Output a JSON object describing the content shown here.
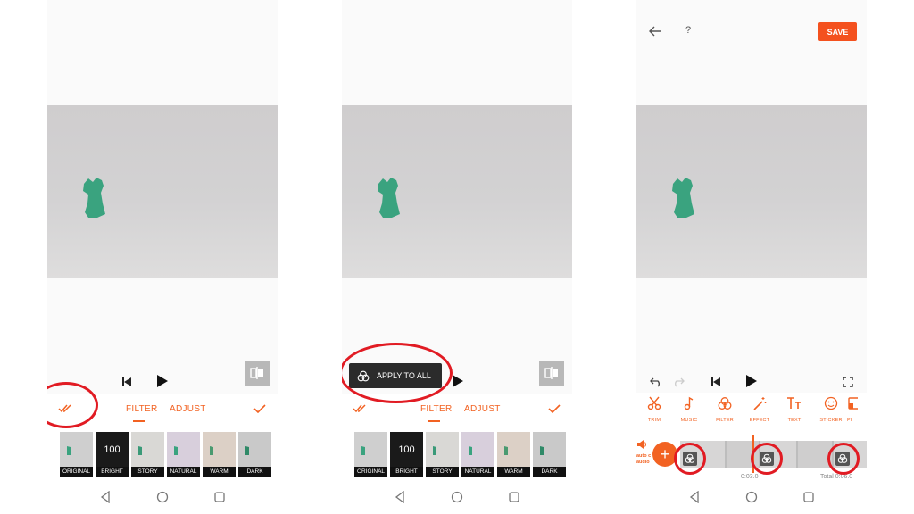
{
  "colors": {
    "accent": "#f26222",
    "highlight_ring": "#e11b23",
    "tooltip_bg": "#2b2b2b",
    "save_bg": "#f4511e"
  },
  "filter_screen": {
    "tabs": {
      "filter": "FILTER",
      "adjust": "ADJUST"
    },
    "icons": [
      "skip-to-start-icon",
      "play-icon",
      "compare-icon",
      "double-check-icon",
      "check-icon"
    ],
    "thumbnails": [
      {
        "label": "ORIGINAL",
        "value": ""
      },
      {
        "label": "BRIGHT",
        "value": "100"
      },
      {
        "label": "STORY",
        "value": ""
      },
      {
        "label": "NATURAL",
        "value": ""
      },
      {
        "label": "WARM",
        "value": ""
      },
      {
        "label": "DARK",
        "value": ""
      }
    ]
  },
  "tooltip": {
    "apply_to_all": "APPLY TO ALL"
  },
  "editor_screen": {
    "save_label": "SAVE",
    "tools": [
      {
        "label": "TRIM",
        "icon": "scissors-icon"
      },
      {
        "label": "MUSIC",
        "icon": "music-note-icon"
      },
      {
        "label": "FILTER",
        "icon": "filter-icon"
      },
      {
        "label": "EFFECT",
        "icon": "magic-wand-icon"
      },
      {
        "label": "TEXT",
        "icon": "text-icon"
      },
      {
        "label": "STICKER",
        "icon": "sticker-icon"
      },
      {
        "label": "PI",
        "icon": "pip-icon"
      }
    ],
    "audio_label_1": "auto c",
    "audio_label_2": "audio",
    "current_time": "0:03.0",
    "total_time": "Total 0:06.0"
  }
}
